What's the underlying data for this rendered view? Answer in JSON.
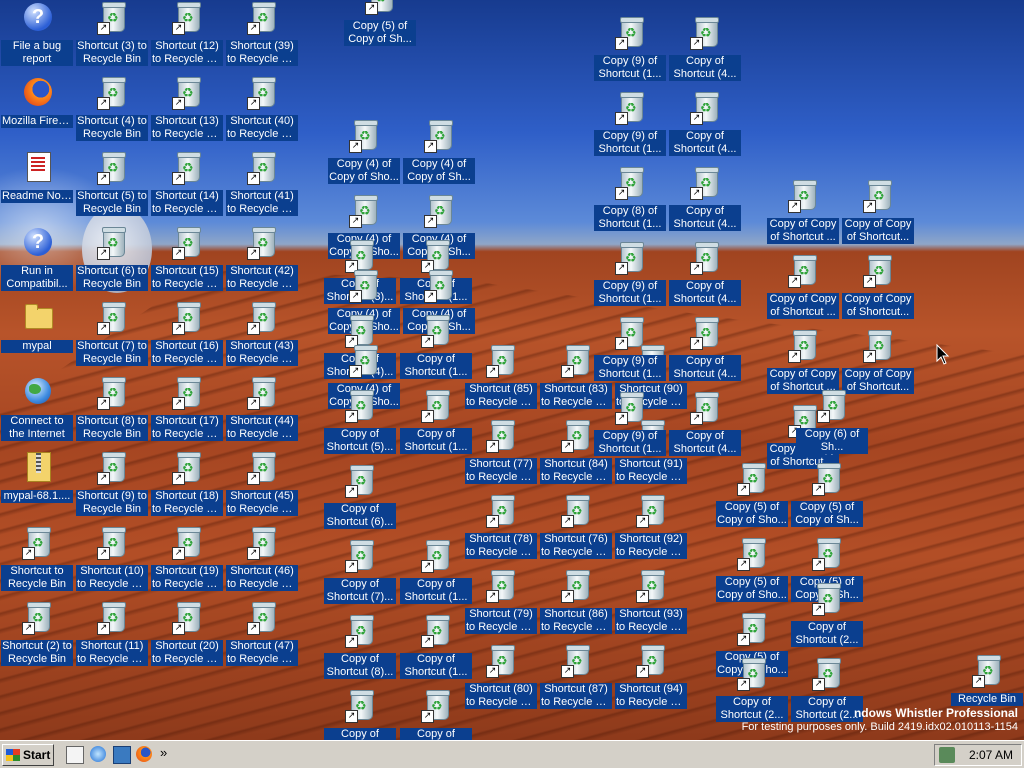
{
  "desktop": {
    "icons": [
      {
        "line1": "File a bug",
        "line2": "report",
        "icon": "help-icon"
      },
      {
        "line1": "Mozilla Firefox",
        "line2": "",
        "icon": "firefox-icon"
      },
      {
        "line1": "Readme Notes",
        "line2": "",
        "icon": "notes-icon"
      },
      {
        "line1": "Run in",
        "line2": "Compatibil...",
        "icon": "help-icon"
      },
      {
        "line1": "mypal",
        "line2": "",
        "icon": "folder-icon"
      },
      {
        "line1": "Connect to",
        "line2": "the Internet",
        "icon": "globe-icon"
      },
      {
        "line1": "mypal-68.1....",
        "line2": "",
        "icon": "zip-icon"
      },
      {
        "line1": "Shortcut to",
        "line2": "Recycle Bin",
        "icon": "recycle-bin-icon"
      },
      {
        "line1": "Shortcut (2) to",
        "line2": "Recycle Bin",
        "icon": "recycle-bin-icon"
      },
      {
        "line1": "Shortcut (3) to",
        "line2": "Recycle Bin",
        "icon": "recycle-bin-icon"
      },
      {
        "line1": "Shortcut (4) to",
        "line2": "Recycle Bin",
        "icon": "recycle-bin-icon"
      },
      {
        "line1": "Shortcut (5) to",
        "line2": "Recycle Bin",
        "icon": "recycle-bin-icon"
      },
      {
        "line1": "Shortcut (6) to",
        "line2": "Recycle Bin",
        "icon": "recycle-bin-icon"
      },
      {
        "line1": "Shortcut (7) to",
        "line2": "Recycle Bin",
        "icon": "recycle-bin-icon"
      },
      {
        "line1": "Shortcut (8) to",
        "line2": "Recycle Bin",
        "icon": "recycle-bin-icon"
      },
      {
        "line1": "Shortcut (9) to",
        "line2": "Recycle Bin",
        "icon": "recycle-bin-icon"
      },
      {
        "line1": "Shortcut (10)",
        "line2": "to Recycle Bin",
        "icon": "recycle-bin-icon"
      },
      {
        "line1": "Shortcut (11)",
        "line2": "to Recycle Bin",
        "icon": "recycle-bin-icon"
      },
      {
        "line1": "Shortcut (12)",
        "line2": "to Recycle Bin",
        "icon": "recycle-bin-icon"
      },
      {
        "line1": "Shortcut (13)",
        "line2": "to Recycle Bin",
        "icon": "recycle-bin-icon"
      },
      {
        "line1": "Shortcut (14)",
        "line2": "to Recycle Bin",
        "icon": "recycle-bin-icon"
      },
      {
        "line1": "Shortcut (15)",
        "line2": "to Recycle Bin",
        "icon": "recycle-bin-icon"
      },
      {
        "line1": "Shortcut (16)",
        "line2": "to Recycle Bin",
        "icon": "recycle-bin-icon"
      },
      {
        "line1": "Shortcut (17)",
        "line2": "to Recycle Bin",
        "icon": "recycle-bin-icon"
      },
      {
        "line1": "Shortcut (18)",
        "line2": "to Recycle Bin",
        "icon": "recycle-bin-icon"
      },
      {
        "line1": "Shortcut (19)",
        "line2": "to Recycle Bin",
        "icon": "recycle-bin-icon"
      },
      {
        "line1": "Shortcut (20)",
        "line2": "to Recycle Bin",
        "icon": "recycle-bin-icon"
      },
      {
        "line1": "Shortcut (39)",
        "line2": "to Recycle Bin",
        "icon": "recycle-bin-icon"
      },
      {
        "line1": "Shortcut (40)",
        "line2": "to Recycle Bin",
        "icon": "recycle-bin-icon"
      },
      {
        "line1": "Shortcut (41)",
        "line2": "to Recycle Bin",
        "icon": "recycle-bin-icon"
      },
      {
        "line1": "Shortcut (42)",
        "line2": "to Recycle Bin",
        "icon": "recycle-bin-icon"
      },
      {
        "line1": "Shortcut (43)",
        "line2": "to Recycle Bin",
        "icon": "recycle-bin-icon"
      },
      {
        "line1": "Shortcut (44)",
        "line2": "to Recycle Bin",
        "icon": "recycle-bin-icon"
      },
      {
        "line1": "Shortcut (45)",
        "line2": "to Recycle Bin",
        "icon": "recycle-bin-icon"
      },
      {
        "line1": "Shortcut (46)",
        "line2": "to Recycle Bin",
        "icon": "recycle-bin-icon"
      },
      {
        "line1": "Shortcut (47)",
        "line2": "to Recycle Bin",
        "icon": "recycle-bin-icon"
      },
      {
        "line1": "Copy (5) of",
        "line2": "Copy of Sh...",
        "icon": "recycle-bin-icon"
      },
      {
        "line1": "Copy (4) of",
        "line2": "Copy of Sho...",
        "icon": "recycle-bin-icon"
      },
      {
        "line1": "Copy (4) of",
        "line2": "Copy of Sh...",
        "icon": "recycle-bin-icon"
      },
      {
        "line1": "Copy (4) of",
        "line2": "Copy of Sho...",
        "icon": "recycle-bin-icon"
      },
      {
        "line1": "Copy (4) of",
        "line2": "Copy of Sh...",
        "icon": "recycle-bin-icon"
      },
      {
        "line1": "Copy of",
        "line2": "Shortcut (3)...",
        "icon": "recycle-bin-icon"
      },
      {
        "line1": "Copy of",
        "line2": "Shortcut (1...",
        "icon": "recycle-bin-icon"
      },
      {
        "line1": "Copy (4) of",
        "line2": "Copy of Sho...",
        "icon": "recycle-bin-icon"
      },
      {
        "line1": "Copy (4) of",
        "line2": "Copy of Sh...",
        "icon": "recycle-bin-icon"
      },
      {
        "line1": "Copy of",
        "line2": "Shortcut (4)...",
        "icon": "recycle-bin-icon"
      },
      {
        "line1": "Copy of",
        "line2": "Shortcut (1...",
        "icon": "recycle-bin-icon"
      },
      {
        "line1": "Copy (4) of",
        "line2": "Copy of Sho...",
        "icon": "recycle-bin-icon"
      },
      {
        "line1": "Copy of",
        "line2": "Shortcut (5)...",
        "icon": "recycle-bin-icon"
      },
      {
        "line1": "Copy of",
        "line2": "Shortcut (1...",
        "icon": "recycle-bin-icon"
      },
      {
        "line1": "Copy of",
        "line2": "Shortcut (6)...",
        "icon": "recycle-bin-icon"
      },
      {
        "line1": "Copy of",
        "line2": "Shortcut (7)...",
        "icon": "recycle-bin-icon"
      },
      {
        "line1": "Copy of",
        "line2": "Shortcut (1...",
        "icon": "recycle-bin-icon"
      },
      {
        "line1": "Copy of",
        "line2": "Shortcut (8)...",
        "icon": "recycle-bin-icon"
      },
      {
        "line1": "Copy of",
        "line2": "Shortcut (1...",
        "icon": "recycle-bin-icon"
      },
      {
        "line1": "Copy of",
        "line2": "",
        "icon": "recycle-bin-icon"
      },
      {
        "line1": "Copy of",
        "line2": "",
        "icon": "recycle-bin-icon"
      },
      {
        "line1": "Shortcut (85)",
        "line2": "to Recycle Bin",
        "icon": "recycle-bin-icon"
      },
      {
        "line1": "Shortcut (83)",
        "line2": "to Recycle Bin",
        "icon": "recycle-bin-icon"
      },
      {
        "line1": "Shortcut (90)",
        "line2": "to Recycle Bin",
        "icon": "recycle-bin-icon"
      },
      {
        "line1": "Shortcut (77)",
        "line2": "to Recycle Bin",
        "icon": "recycle-bin-icon"
      },
      {
        "line1": "Shortcut (84)",
        "line2": "to Recycle Bin",
        "icon": "recycle-bin-icon"
      },
      {
        "line1": "Shortcut (91)",
        "line2": "to Recycle Bin",
        "icon": "recycle-bin-icon"
      },
      {
        "line1": "Shortcut (78)",
        "line2": "to Recycle Bin",
        "icon": "recycle-bin-icon"
      },
      {
        "line1": "Shortcut (76)",
        "line2": "to Recycle Bin",
        "icon": "recycle-bin-icon"
      },
      {
        "line1": "Shortcut (92)",
        "line2": "to Recycle Bin",
        "icon": "recycle-bin-icon"
      },
      {
        "line1": "Shortcut (79)",
        "line2": "to Recycle Bin",
        "icon": "recycle-bin-icon"
      },
      {
        "line1": "Shortcut (86)",
        "line2": "to Recycle Bin",
        "icon": "recycle-bin-icon"
      },
      {
        "line1": "Shortcut (93)",
        "line2": "to Recycle Bin",
        "icon": "recycle-bin-icon"
      },
      {
        "line1": "Shortcut (80)",
        "line2": "to Recycle Bin",
        "icon": "recycle-bin-icon"
      },
      {
        "line1": "Shortcut (87)",
        "line2": "to Recycle Bin",
        "icon": "recycle-bin-icon"
      },
      {
        "line1": "Shortcut (94)",
        "line2": "to Recycle Bin",
        "icon": "recycle-bin-icon"
      },
      {
        "line1": "Copy (9) of",
        "line2": "Shortcut (1...",
        "icon": "recycle-bin-icon"
      },
      {
        "line1": "Copy of",
        "line2": "Shortcut (4...",
        "icon": "recycle-bin-icon"
      },
      {
        "line1": "Copy (9) of",
        "line2": "Shortcut (1...",
        "icon": "recycle-bin-icon"
      },
      {
        "line1": "Copy of",
        "line2": "Shortcut (4...",
        "icon": "recycle-bin-icon"
      },
      {
        "line1": "Copy (8) of",
        "line2": "Shortcut (1...",
        "icon": "recycle-bin-icon"
      },
      {
        "line1": "Copy of",
        "line2": "Shortcut (4...",
        "icon": "recycle-bin-icon"
      },
      {
        "line1": "Copy (9) of",
        "line2": "Shortcut (1...",
        "icon": "recycle-bin-icon"
      },
      {
        "line1": "Copy of",
        "line2": "Shortcut (4...",
        "icon": "recycle-bin-icon"
      },
      {
        "line1": "Copy (9) of",
        "line2": "Shortcut (1...",
        "icon": "recycle-bin-icon"
      },
      {
        "line1": "Copy of",
        "line2": "Shortcut (4...",
        "icon": "recycle-bin-icon"
      },
      {
        "line1": "Copy (9) of",
        "line2": "Shortcut (1...",
        "icon": "recycle-bin-icon"
      },
      {
        "line1": "Copy of",
        "line2": "Shortcut (4...",
        "icon": "recycle-bin-icon"
      },
      {
        "line1": "Copy of Copy",
        "line2": "of Shortcut ...",
        "icon": "recycle-bin-icon"
      },
      {
        "line1": "Copy of Copy",
        "line2": "of Shortcut...",
        "icon": "recycle-bin-icon"
      },
      {
        "line1": "Copy of Copy",
        "line2": "of Shortcut ...",
        "icon": "recycle-bin-icon"
      },
      {
        "line1": "Copy of Copy",
        "line2": "of Shortcut...",
        "icon": "recycle-bin-icon"
      },
      {
        "line1": "Copy of Copy",
        "line2": "of Shortcut ...",
        "icon": "recycle-bin-icon"
      },
      {
        "line1": "Copy of Copy",
        "line2": "of Shortcut...",
        "icon": "recycle-bin-icon"
      },
      {
        "line1": "Copy of Copy",
        "line2": "of Shortcut ...",
        "icon": "recycle-bin-icon"
      },
      {
        "line1": "Copy (6) of",
        "line2": "Sh...",
        "icon": "recycle-bin-icon"
      },
      {
        "line1": "Copy (5) of",
        "line2": "Copy of Sho...",
        "icon": "recycle-bin-icon"
      },
      {
        "line1": "Copy (5) of",
        "line2": "Copy of Sh...",
        "icon": "recycle-bin-icon"
      },
      {
        "line1": "Copy (5) of",
        "line2": "Copy of Sho...",
        "icon": "recycle-bin-icon"
      },
      {
        "line1": "Copy (5) of",
        "line2": "Copy of Sh...",
        "icon": "recycle-bin-icon"
      },
      {
        "line1": "Copy of",
        "line2": "Shortcut (2...",
        "icon": "recycle-bin-icon"
      },
      {
        "line1": "Copy (5) of",
        "line2": "Copy of Sho...",
        "icon": "recycle-bin-icon"
      },
      {
        "line1": "Copy of",
        "line2": "Shortcut (2...",
        "icon": "recycle-bin-icon"
      },
      {
        "line1": "Copy of",
        "line2": "Shortcut (2...",
        "icon": "recycle-bin-icon"
      },
      {
        "line1": "Recycle Bin",
        "line2": "",
        "icon": "recycle-bin-icon"
      }
    ]
  },
  "watermark": {
    "line1": "ndows Whistler Professional",
    "line2": "For testing purposes only. Build 2419.idx02.010113-1154"
  },
  "taskbar": {
    "start_label": "Start",
    "quick_launch": [
      "show-desktop-icon",
      "internet-explorer-icon",
      "media-player-icon",
      "firefox-icon"
    ],
    "chevron": "»",
    "tray_icon": "network-icon",
    "clock": "2:07 AM"
  }
}
